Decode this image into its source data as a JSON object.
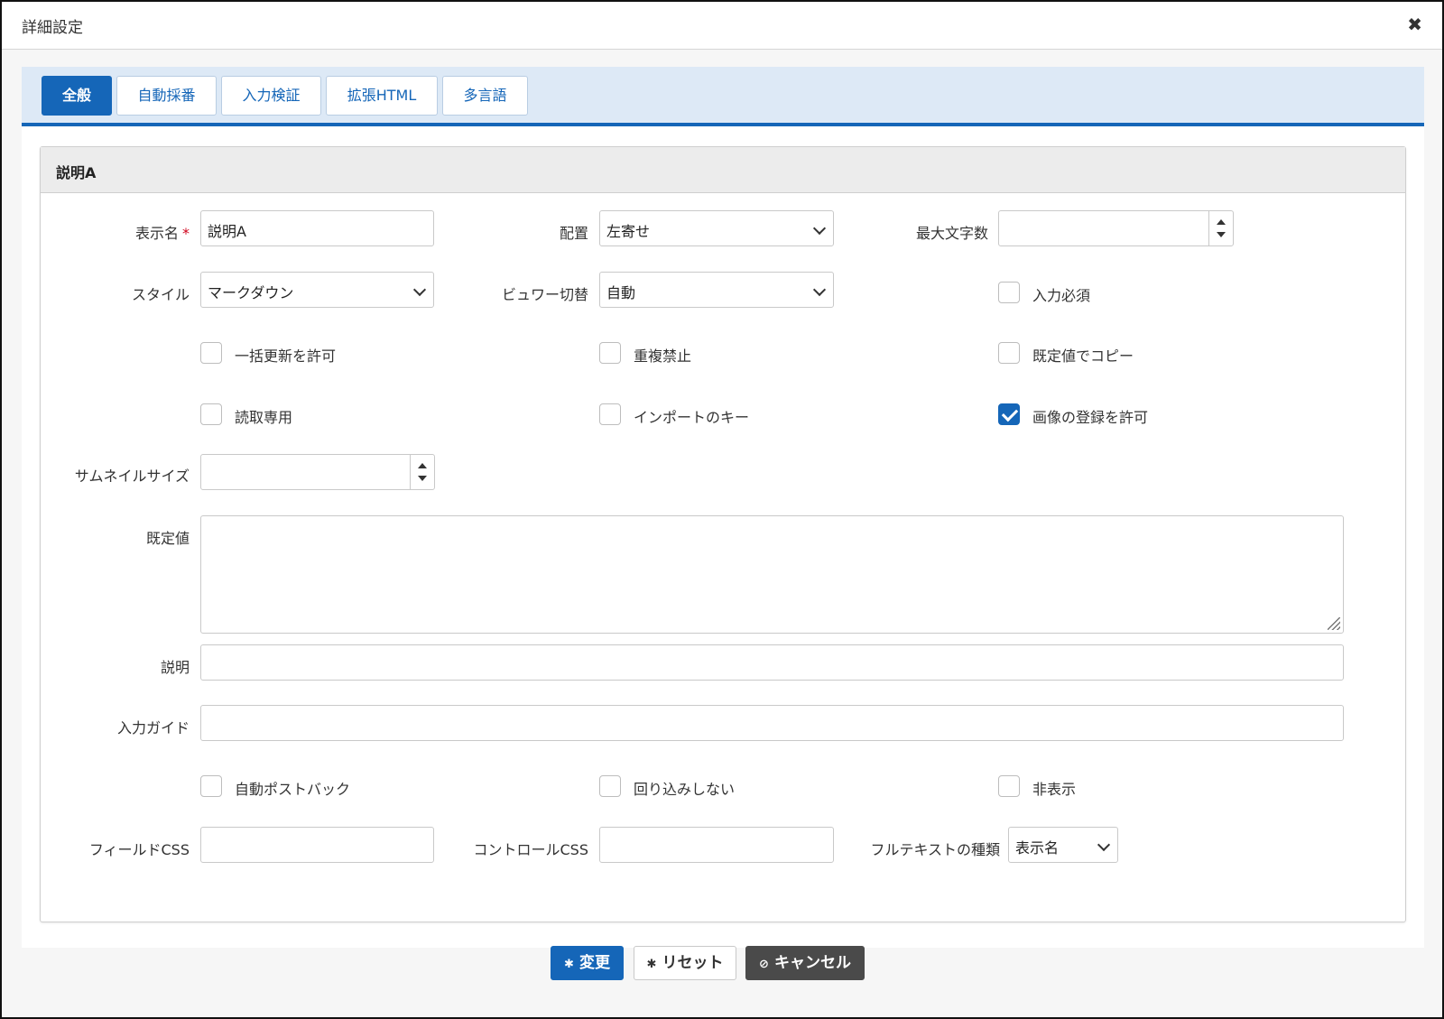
{
  "dialog": {
    "title": "詳細設定"
  },
  "tabs": [
    "全般",
    "自動採番",
    "入力検証",
    "拡張HTML",
    "多言語"
  ],
  "panel": {
    "title": "説明A"
  },
  "fields": {
    "display_name": {
      "label": "表示名",
      "required_mark": "*",
      "value": "説明A"
    },
    "alignment": {
      "label": "配置",
      "value": "左寄せ"
    },
    "max_chars": {
      "label": "最大文字数",
      "value": ""
    },
    "style": {
      "label": "スタイル",
      "value": "マークダウン"
    },
    "viewer_switch": {
      "label": "ビュワー切替",
      "value": "自動"
    },
    "thumbnail_size": {
      "label": "サムネイルサイズ",
      "value": ""
    },
    "default_value": {
      "label": "既定値",
      "value": ""
    },
    "description": {
      "label": "説明",
      "value": ""
    },
    "input_guide": {
      "label": "入力ガイド",
      "value": ""
    },
    "field_css": {
      "label": "フィールドCSS",
      "value": ""
    },
    "control_css": {
      "label": "コントロールCSS",
      "value": ""
    },
    "fulltext_type": {
      "label": "フルテキストの種類",
      "value": "表示名"
    }
  },
  "checkboxes": {
    "required": {
      "label": "入力必須",
      "checked": false
    },
    "bulk_update": {
      "label": "一括更新を許可",
      "checked": false
    },
    "no_duplicates": {
      "label": "重複禁止",
      "checked": false
    },
    "copy_default": {
      "label": "既定値でコピー",
      "checked": false
    },
    "read_only": {
      "label": "読取専用",
      "checked": false
    },
    "import_key": {
      "label": "インポートのキー",
      "checked": false
    },
    "allow_image": {
      "label": "画像の登録を許可",
      "checked": true
    },
    "auto_postback": {
      "label": "自動ポストバック",
      "checked": false
    },
    "no_wrap": {
      "label": "回り込みしない",
      "checked": false
    },
    "hidden": {
      "label": "非表示",
      "checked": false
    }
  },
  "buttons": {
    "change": "変更",
    "reset": "リセット",
    "cancel": "キャンセル"
  },
  "icons": {
    "close": "close-icon",
    "gear": "gear-icon",
    "cancel": "cancel-icon"
  },
  "colors": {
    "accent": "#1566b8",
    "tab_bar": "#dde9f6",
    "dark_button": "#4a4a4a",
    "required": "#d0021b"
  }
}
